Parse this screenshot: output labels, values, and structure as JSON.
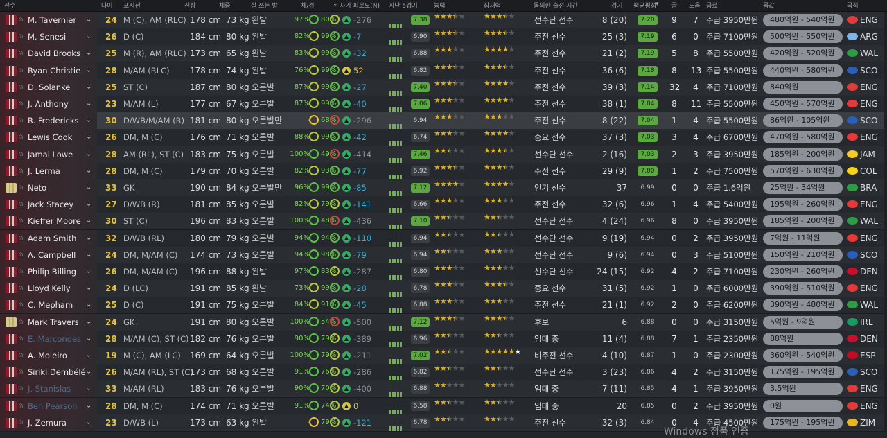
{
  "headers": {
    "player": "선수",
    "age": "나이",
    "position": "포지션",
    "height": "신장",
    "weight": "체중",
    "foot": "잘 쓰는 발",
    "condition": "체/경",
    "morale_sort": "사기 피로도(N)",
    "form": "지난 5경기",
    "ability": "능력",
    "potential": "잠재력",
    "playing_time": "동의한 출전 시간",
    "apps": "경기",
    "avg_rating": "평균평점",
    "goals": "골",
    "assists": "도움",
    "wage": "급료",
    "value": "몸값",
    "nationality": "국적"
  },
  "players": [
    {
      "name": "M. Tavernier",
      "age": "24",
      "pos": "M (C), AM (RLC)",
      "height": "178 cm",
      "weight": "73 kg",
      "foot": "왼발",
      "cond": "97%",
      "sharp": "80%",
      "morale": "-276",
      "form_rating": "7.38",
      "ability": 3.5,
      "potential": 3.5,
      "status": "선수단 선수",
      "apps": "8 (20)",
      "avg": "7.20",
      "goals": "9",
      "assists": "7",
      "wage": "주급 3950만원",
      "value": "480억원 - 540억원",
      "flag": "ENG",
      "nat": "ENG",
      "kit": "outfield",
      "loan": false
    },
    {
      "name": "M. Senesi",
      "age": "26",
      "pos": "D (C)",
      "height": "184 cm",
      "weight": "80 kg",
      "foot": "왼발",
      "cond": "82%",
      "sharp": "99%",
      "morale": "-7",
      "form_rating": "6.90",
      "ability": 3.5,
      "potential": 3.5,
      "status": "주전 선수",
      "apps": "25 (3)",
      "avg": "7.19",
      "goals": "6",
      "assists": "0",
      "wage": "주급 7100만원",
      "value": "500억원 - 550억원",
      "flag": "ARG",
      "nat": "ARG",
      "kit": "outfield",
      "loan": false
    },
    {
      "name": "David Brooks",
      "age": "25",
      "pos": "M (R), AM (RLC)",
      "height": "173 cm",
      "weight": "65 kg",
      "foot": "왼발",
      "cond": "83%",
      "sharp": "99%",
      "morale": "-32",
      "form_rating": "6.88",
      "ability": 3,
      "potential": 4,
      "status": "주전 선수",
      "apps": "21 (2)",
      "avg": "7.19",
      "goals": "5",
      "assists": "8",
      "wage": "주급 5500만원",
      "value": "420억원 - 520억원",
      "flag": "WAL",
      "nat": "WAL",
      "kit": "outfield",
      "loan": false
    },
    {
      "name": "Ryan Christie",
      "age": "28",
      "pos": "M/AM (RLC)",
      "height": "178 cm",
      "weight": "74 kg",
      "foot": "왼발",
      "cond": "76%",
      "sharp": "99%",
      "morale": "52",
      "form_rating": "6.82",
      "ability": 3.5,
      "potential": 3.5,
      "status": "주전 선수",
      "apps": "36 (6)",
      "avg": "7.18",
      "goals": "8",
      "assists": "13",
      "wage": "주급 5500만원",
      "value": "440억원 - 580억원",
      "flag": "SCO",
      "nat": "SCO",
      "kit": "outfield",
      "loan": false
    },
    {
      "name": "D. Solanke",
      "age": "25",
      "pos": "ST (C)",
      "height": "187 cm",
      "weight": "80 kg",
      "foot": "오른발",
      "cond": "87%",
      "sharp": "99%",
      "morale": "-27",
      "form_rating": "7.40",
      "ability": 3.5,
      "potential": 4,
      "status": "주전 선수",
      "apps": "39 (3)",
      "avg": "7.14",
      "goals": "32",
      "assists": "4",
      "wage": "주급 7100만원",
      "value": "840억원",
      "flag": "ENG",
      "nat": "ENG",
      "kit": "outfield",
      "loan": false
    },
    {
      "name": "J. Anthony",
      "age": "23",
      "pos": "M/AM (L)",
      "height": "177 cm",
      "weight": "67 kg",
      "foot": "오른발",
      "cond": "87%",
      "sharp": "99%",
      "morale": "-40",
      "form_rating": "7.06",
      "ability": 3,
      "potential": 4,
      "status": "주전 선수",
      "apps": "38 (1)",
      "avg": "7.04",
      "goals": "8",
      "assists": "11",
      "wage": "주급 5500만원",
      "value": "450억원 - 570억원",
      "flag": "ENG",
      "nat": "ENG",
      "kit": "outfield",
      "loan": false
    },
    {
      "name": "R. Fredericks",
      "age": "30",
      "pos": "D/WB/M/AM (R)",
      "height": "181 cm",
      "weight": "80 kg",
      "foot": "오른발만",
      "cond": "-",
      "sharp": "68%",
      "morale": "-296",
      "form_rating": "6.94",
      "ability": 3,
      "potential": 3,
      "status": "주전 선수",
      "apps": "8 (22)",
      "avg": "7.04",
      "goals": "1",
      "assists": "4",
      "wage": "주급 5500만원",
      "value": "86억원 - 105억원",
      "flag": "SCO",
      "nat": "SCO",
      "kit": "outfield",
      "loan": false
    },
    {
      "name": "Lewis Cook",
      "age": "26",
      "pos": "DM, M (C)",
      "height": "176 cm",
      "weight": "71 kg",
      "foot": "오른발",
      "cond": "88%",
      "sharp": "99%",
      "morale": "-42",
      "form_rating": "6.74",
      "ability": 3,
      "potential": 4,
      "status": "중요 선수",
      "apps": "37 (3)",
      "avg": "7.03",
      "goals": "3",
      "assists": "4",
      "wage": "주급 6700만원",
      "value": "470억원 - 580억원",
      "flag": "ENG",
      "nat": "ENG",
      "kit": "outfield",
      "loan": false
    },
    {
      "name": "Jamal Lowe",
      "age": "28",
      "pos": "AM (RL), ST (C)",
      "height": "183 cm",
      "weight": "75 kg",
      "foot": "오른발",
      "cond": "100%",
      "sharp": "49%",
      "morale": "-414",
      "form_rating": "7.46",
      "ability": 2.5,
      "potential": 3.5,
      "status": "선수단 선수",
      "apps": "2 (16)",
      "avg": "7.03",
      "goals": "2",
      "assists": "3",
      "wage": "주급 3950만원",
      "value": "185억원 - 200억원",
      "flag": "JAM",
      "nat": "JAM",
      "kit": "outfield",
      "loan": false
    },
    {
      "name": "J. Lerma",
      "age": "28",
      "pos": "DM, M (C)",
      "height": "179 cm",
      "weight": "70 kg",
      "foot": "오른발",
      "cond": "82%",
      "sharp": "93%",
      "morale": "-77",
      "form_rating": "6.92",
      "ability": 3.5,
      "potential": 3.5,
      "status": "주전 선수",
      "apps": "29 (9)",
      "avg": "7.00",
      "goals": "1",
      "assists": "2",
      "wage": "주급 7500만원",
      "value": "570억원 - 630억원",
      "flag": "COL",
      "nat": "COL",
      "kit": "outfield",
      "loan": false
    },
    {
      "name": "Neto",
      "age": "33",
      "pos": "GK",
      "height": "190 cm",
      "weight": "84 kg",
      "foot": "오른발만",
      "cond": "96%",
      "sharp": "99%",
      "morale": "-85",
      "form_rating": "7.12",
      "ability": 4,
      "potential": 4,
      "status": "인기 선수",
      "apps": "37",
      "avg": "6.99",
      "goals": "0",
      "assists": "0",
      "wage": "주급 1.6억원",
      "value": "25억원 - 34억원",
      "flag": "BRA",
      "nat": "BRA",
      "kit": "gk",
      "loan": false
    },
    {
      "name": "Jack Stacey",
      "age": "27",
      "pos": "D/WB (R)",
      "height": "181 cm",
      "weight": "85 kg",
      "foot": "오른발",
      "cond": "82%",
      "sharp": "79%",
      "morale": "-141",
      "form_rating": "6.66",
      "ability": 3,
      "potential": 3,
      "status": "주전 선수",
      "apps": "32 (6)",
      "avg": "6.96",
      "goals": "1",
      "assists": "4",
      "wage": "주급 5400만원",
      "value": "195억원 - 260억원",
      "flag": "ENG",
      "nat": "ENG",
      "kit": "outfield",
      "loan": false
    },
    {
      "name": "Kieffer Moore",
      "age": "30",
      "pos": "ST (C)",
      "height": "196 cm",
      "weight": "83 kg",
      "foot": "오른발",
      "cond": "100%",
      "sharp": "48%",
      "morale": "-436",
      "form_rating": "7.10",
      "ability": 2.5,
      "potential": 2.5,
      "status": "선수단 선수",
      "apps": "4 (24)",
      "avg": "6.96",
      "goals": "8",
      "assists": "0",
      "wage": "주급 3950만원",
      "value": "185억원 - 200억원",
      "flag": "WAL",
      "nat": "WAL",
      "kit": "outfield",
      "loan": false
    },
    {
      "name": "Adam Smith",
      "age": "32",
      "pos": "D/WB (RL)",
      "height": "180 cm",
      "weight": "79 kg",
      "foot": "오른발",
      "cond": "94%",
      "sharp": "94%",
      "morale": "-110",
      "form_rating": "6.94",
      "ability": 2.5,
      "potential": 2.5,
      "status": "선수단 선수",
      "apps": "9 (19)",
      "avg": "6.94",
      "goals": "0",
      "assists": "2",
      "wage": "주급 3950만원",
      "value": "7억원 - 11억원",
      "flag": "ENG",
      "nat": "ENG",
      "kit": "outfield",
      "loan": false
    },
    {
      "name": "A. Campbell",
      "age": "24",
      "pos": "DM, M/AM (C)",
      "height": "174 cm",
      "weight": "73 kg",
      "foot": "오른발",
      "cond": "94%",
      "sharp": "98%",
      "morale": "-79",
      "form_rating": "6.94",
      "ability": 2.5,
      "potential": 3,
      "status": "선수단 선수",
      "apps": "9 (6)",
      "avg": "6.94",
      "goals": "0",
      "assists": "3",
      "wage": "주급 5100만원",
      "value": "150억원 - 210억원",
      "flag": "SCO",
      "nat": "SCO",
      "kit": "outfield",
      "loan": false
    },
    {
      "name": "Philip Billing",
      "age": "26",
      "pos": "DM, M/AM (C)",
      "height": "196 cm",
      "weight": "88 kg",
      "foot": "왼발",
      "cond": "97%",
      "sharp": "83%",
      "morale": "-287",
      "form_rating": "6.80",
      "ability": 3,
      "potential": 3,
      "status": "선수단 선수",
      "apps": "24 (15)",
      "avg": "6.92",
      "goals": "4",
      "assists": "2",
      "wage": "주급 7100만원",
      "value": "230억원 - 260억원",
      "flag": "DEN",
      "nat": "DEN",
      "kit": "outfield",
      "loan": false
    },
    {
      "name": "Lloyd Kelly",
      "age": "24",
      "pos": "D (LC)",
      "height": "191 cm",
      "weight": "85 kg",
      "foot": "왼발",
      "cond": "73%",
      "sharp": "99%",
      "morale": "-28",
      "form_rating": "6.78",
      "ability": 3,
      "potential": 3.5,
      "status": "중요 선수",
      "apps": "31 (5)",
      "avg": "6.92",
      "goals": "1",
      "assists": "0",
      "wage": "주급 6000만원",
      "value": "390억원 - 510억원",
      "flag": "ENG",
      "nat": "ENG",
      "kit": "outfield",
      "loan": false
    },
    {
      "name": "C. Mepham",
      "age": "25",
      "pos": "D (C)",
      "height": "191 cm",
      "weight": "75 kg",
      "foot": "오른발",
      "cond": "84%",
      "sharp": "91%",
      "morale": "-45",
      "form_rating": "6.88",
      "ability": 3,
      "potential": 3,
      "status": "주전 선수",
      "apps": "21 (1)",
      "avg": "6.92",
      "goals": "2",
      "assists": "0",
      "wage": "주급 6200만원",
      "value": "390억원 - 480억원",
      "flag": "WAL",
      "nat": "WAL",
      "kit": "outfield",
      "loan": false
    },
    {
      "name": "Mark Travers",
      "age": "24",
      "pos": "GK",
      "height": "191 cm",
      "weight": "80 kg",
      "foot": "오른발",
      "cond": "100%",
      "sharp": "54%",
      "morale": "-500",
      "form_rating": "7.12",
      "ability": 3.5,
      "potential": 3.5,
      "status": "후보",
      "apps": "6",
      "avg": "6.88",
      "goals": "0",
      "assists": "0",
      "wage": "주급 3150만원",
      "value": "5억원 - 9억원",
      "flag": "IRL",
      "nat": "IRL",
      "kit": "gk",
      "loan": false
    },
    {
      "name": "E. Marcondes",
      "age": "28",
      "pos": "M/AM (C), ST (C)",
      "height": "182 cm",
      "weight": "76 kg",
      "foot": "오른발",
      "cond": "90%",
      "sharp": "79%",
      "morale": "-389",
      "form_rating": "6.96",
      "ability": 2.5,
      "potential": 2.5,
      "status": "임대 중",
      "apps": "11 (4)",
      "avg": "6.88",
      "goals": "7",
      "assists": "1",
      "wage": "주급 2350만원",
      "value": "88억원",
      "flag": "DEN",
      "nat": "DEN",
      "kit": "outfield",
      "loan": true
    },
    {
      "name": "A. Moleiro",
      "age": "19",
      "pos": "M (C), AM (LC)",
      "height": "169 cm",
      "weight": "64 kg",
      "foot": "오른발",
      "cond": "100%",
      "sharp": "79%",
      "morale": "-211",
      "form_rating": "7.02",
      "ability": 2.5,
      "potential": 5,
      "status": "비주전 선수",
      "apps": "4 (10)",
      "avg": "6.87",
      "goals": "1",
      "assists": "0",
      "wage": "주급 2300만원",
      "value": "360억원 - 540억원",
      "flag": "ESP",
      "nat": "ESP",
      "kit": "outfield",
      "loan": false
    },
    {
      "name": "Siriki Dembélé",
      "age": "26",
      "pos": "M/AM (RL), ST (C)",
      "height": "173 cm",
      "weight": "68 kg",
      "foot": "오른발",
      "cond": "91%",
      "sharp": "76%",
      "morale": "-286",
      "form_rating": "6.82",
      "ability": 2.5,
      "potential": 2.5,
      "status": "선수단 선수",
      "apps": "3 (23)",
      "avg": "6.86",
      "goals": "4",
      "assists": "2",
      "wage": "주급 3150만원",
      "value": "175억원 - 195억원",
      "flag": "SCO",
      "nat": "SCO",
      "kit": "outfield",
      "loan": false
    },
    {
      "name": "J. Stanislas",
      "age": "33",
      "pos": "M/AM (RL)",
      "height": "183 cm",
      "weight": "76 kg",
      "foot": "오른발",
      "cond": "90%",
      "sharp": "70%",
      "morale": "-400",
      "form_rating": "6.88",
      "ability": 2,
      "potential": 2,
      "status": "임대 중",
      "apps": "7 (11)",
      "avg": "6.85",
      "goals": "4",
      "assists": "1",
      "wage": "주급 3950만원",
      "value": "3.5억원",
      "flag": "ENG",
      "nat": "ENG",
      "kit": "outfield",
      "loan": true
    },
    {
      "name": "Ben Pearson",
      "age": "28",
      "pos": "DM, M (C)",
      "height": "174 cm",
      "weight": "71 kg",
      "foot": "오른발",
      "cond": "91%",
      "sharp": "74%",
      "morale": "0",
      "form_rating": "6.58",
      "ability": 2.5,
      "potential": 2.5,
      "status": "임대 중",
      "apps": "20",
      "avg": "6.85",
      "goals": "0",
      "assists": "2",
      "wage": "주급 3950만원",
      "value": "0원",
      "flag": "ENG",
      "nat": "ENG",
      "kit": "outfield",
      "loan": true
    },
    {
      "name": "J. Zemura",
      "age": "23",
      "pos": "D/WB (L)",
      "height": "173 cm",
      "weight": "63 kg",
      "foot": "왼발",
      "cond": "-",
      "sharp": "79%",
      "morale": "-121",
      "form_rating": "6.78",
      "ability": 2.5,
      "potential": 2.5,
      "status": "주전 선수",
      "apps": "32 (3)",
      "avg": "6.84",
      "goals": "0",
      "assists": "4",
      "wage": "주급 4500만원",
      "value": "175억원 - 195억원",
      "flag": "ZIM",
      "nat": "ZIM",
      "kit": "outfield",
      "loan": false
    }
  ],
  "flag_colors": {
    "ENG": "#e33b3b",
    "ARG": "#7fb5e8",
    "WAL": "#2f9b47",
    "SCO": "#2a5fb8",
    "JAM": "#f2cc2a",
    "COL": "#f5d21e",
    "BRA": "#2f9b47",
    "DEN": "#c8102e",
    "IRL": "#169b62",
    "ESP": "#c60b1e",
    "ZIM": "#e8b820"
  },
  "watermark": "Windows 정품 인증"
}
